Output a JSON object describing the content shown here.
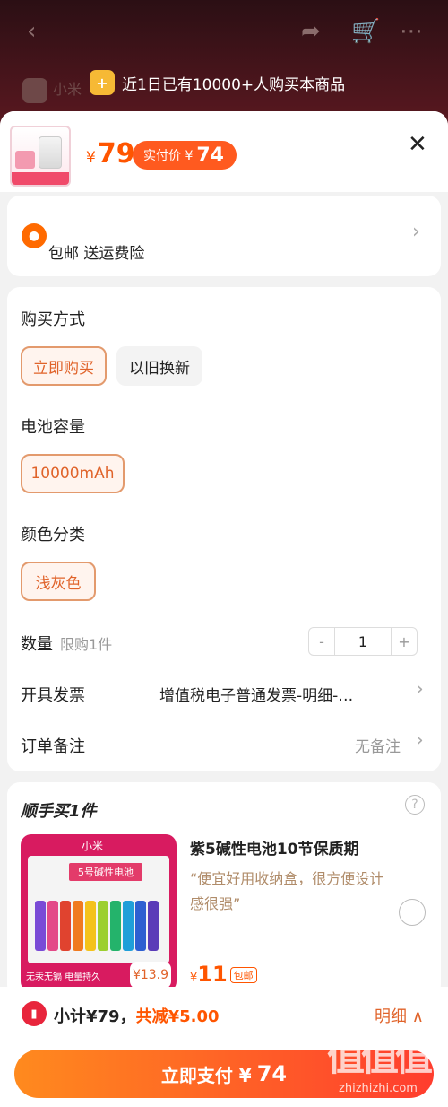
{
  "topbar": {
    "back_icon": "chevron-left-icon",
    "share_icon": "share-icon",
    "cart_icon": "cart-icon",
    "more_icon": "more-icon"
  },
  "banner": {
    "text": "近1日已有10000+人购买本商品"
  },
  "bg_brand": {
    "text": "小米"
  },
  "header": {
    "yen": "¥",
    "price": "79",
    "real_label": "实付价 ¥",
    "real_price": "74"
  },
  "shipping": {
    "text": "包邮  送运费险"
  },
  "options": {
    "purchase_label": "购买方式",
    "purchase_options": [
      "立即购买",
      "以旧换新"
    ],
    "capacity_label": "电池容量",
    "capacity_options": [
      "10000mAh"
    ],
    "color_label": "颜色分类",
    "color_options": [
      "浅灰色"
    ],
    "qty_label": "数量",
    "qty_limit": "限购1件",
    "qty_minus": "-",
    "qty_value": "1",
    "qty_plus": "+",
    "invoice_label": "开具发票",
    "invoice_value": "增值税电子普通发票-明细-…",
    "note_label": "订单备注",
    "note_value": "无备注"
  },
  "upsell": {
    "title": "顺手买1件",
    "help": "?",
    "img_logo": "小米",
    "img_tag": "5号碱性电池",
    "img_foot": "无汞无镉  电量持久",
    "img_price": "¥13.9",
    "name": "紫5碱性电池10节保质期",
    "quote": "“便宜好用收纳盒，很方便设计感很强”",
    "yen": "¥",
    "price": "11",
    "ship_tag": "包邮"
  },
  "footer": {
    "subtotal": "小计¥79，",
    "discount": "共减¥5.00",
    "detail": "明细 ∧",
    "pay_label": "立即支付 ¥",
    "pay_amount": "74"
  },
  "watermark": {
    "glyphs": "值值值",
    "site": "zhizhizhi.com"
  },
  "colors": {
    "accent": "#ff5500",
    "selected_border": "#e39a6d",
    "pay_start": "#ff8a1e",
    "pay_end": "#ff3d2e"
  }
}
